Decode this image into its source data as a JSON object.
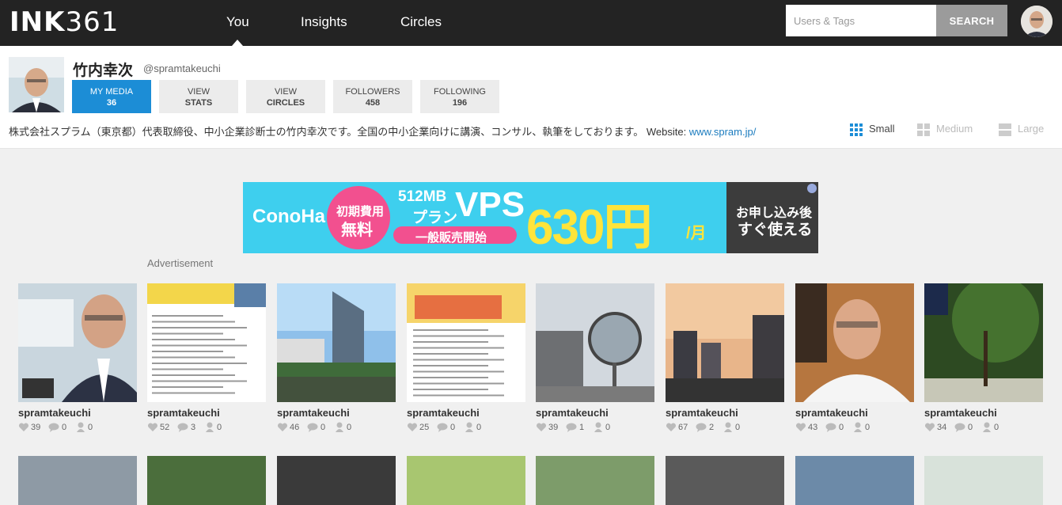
{
  "brand": {
    "logo_a": "INK",
    "logo_b": "361"
  },
  "nav": {
    "items": [
      {
        "label": "You"
      },
      {
        "label": "Insights"
      },
      {
        "label": "Circles"
      }
    ]
  },
  "search": {
    "placeholder": "Users & Tags",
    "button": "SEARCH"
  },
  "profile": {
    "name": "竹内幸次",
    "handle": "@spramtakeuchi",
    "stats": [
      {
        "label": "MY MEDIA",
        "value": "36"
      },
      {
        "label": "VIEW",
        "value": "STATS"
      },
      {
        "label": "VIEW",
        "value": "CIRCLES"
      },
      {
        "label": "FOLLOWERS",
        "value": "458"
      },
      {
        "label": "FOLLOWING",
        "value": "196"
      }
    ],
    "bio": "株式会社スプラム（東京都）代表取締役、中小企業診断士の竹内幸次です。全国の中小企業向けに講演、コンサル、執筆をしております。 Website: ",
    "website": "www.spram.jp/"
  },
  "view_sizes": [
    {
      "label": "Small"
    },
    {
      "label": "Medium"
    },
    {
      "label": "Large"
    }
  ],
  "ad": {
    "brand": "ConoHa",
    "badge": "初期費用 無料",
    "badge_l1": "初期費用",
    "badge_l2": "無料",
    "plan": "512MB",
    "plan_l2": "プラン",
    "vps": "VPS",
    "sale": "一般販売開始",
    "price": "630円",
    "per": "/月",
    "cta1": "お申し込み後",
    "cta2": "すぐ使える",
    "label": "Advertisement"
  },
  "posts": [
    {
      "user": "spramtakeuchi",
      "likes": "39",
      "comments": "0",
      "tags": "0"
    },
    {
      "user": "spramtakeuchi",
      "likes": "52",
      "comments": "3",
      "tags": "0"
    },
    {
      "user": "spramtakeuchi",
      "likes": "46",
      "comments": "0",
      "tags": "0"
    },
    {
      "user": "spramtakeuchi",
      "likes": "25",
      "comments": "0",
      "tags": "0"
    },
    {
      "user": "spramtakeuchi",
      "likes": "39",
      "comments": "1",
      "tags": "0"
    },
    {
      "user": "spramtakeuchi",
      "likes": "67",
      "comments": "2",
      "tags": "0"
    },
    {
      "user": "spramtakeuchi",
      "likes": "43",
      "comments": "0",
      "tags": "0"
    },
    {
      "user": "spramtakeuchi",
      "likes": "34",
      "comments": "0",
      "tags": "0"
    }
  ],
  "colors": {
    "accent": "#1c8dd6",
    "topbar": "#232323"
  }
}
